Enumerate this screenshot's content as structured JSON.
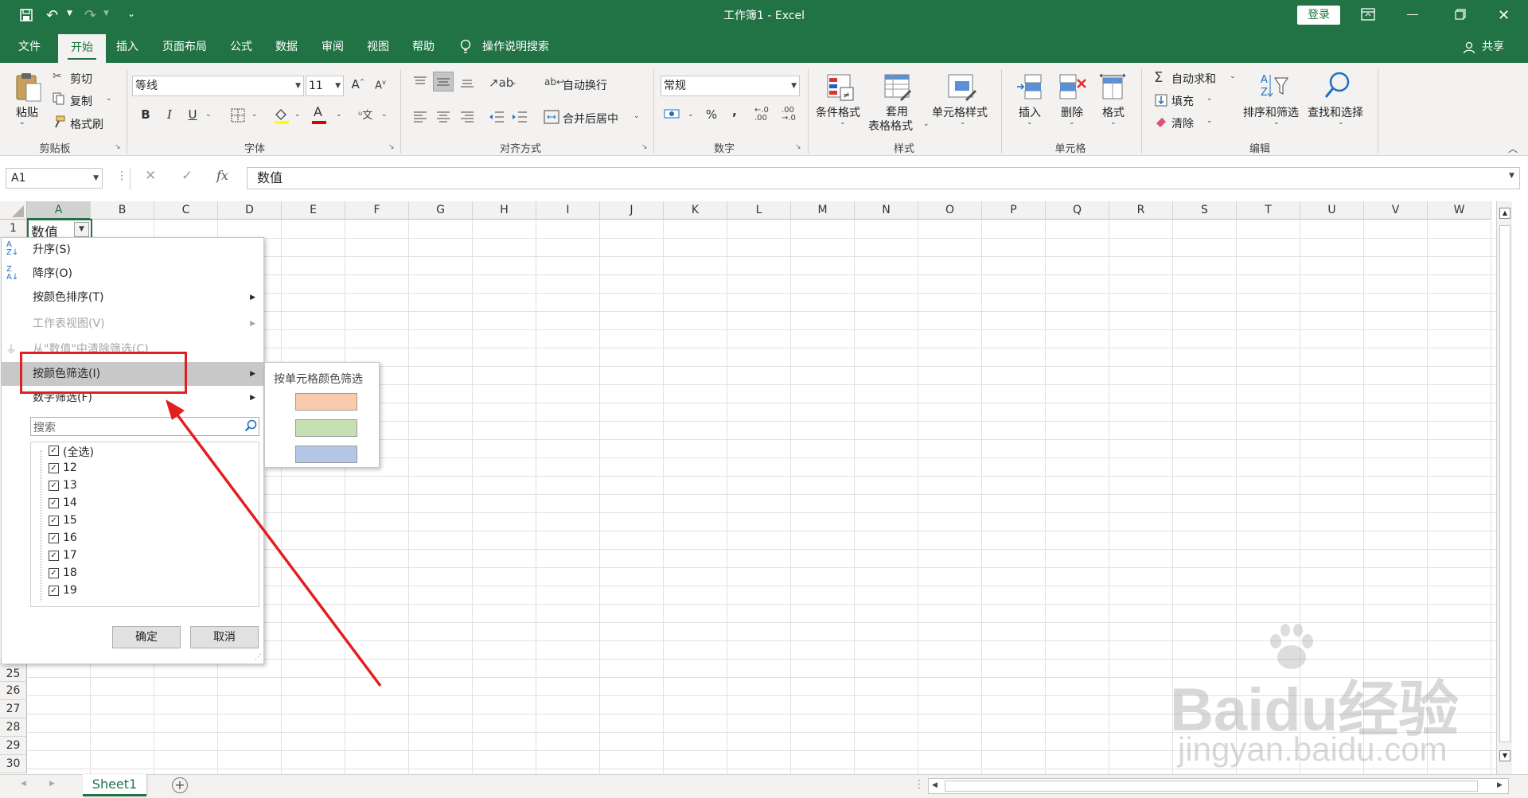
{
  "title_bar": {
    "title": "工作簿1  -  Excel",
    "login_label": "登录"
  },
  "tabs": [
    "文件",
    "开始",
    "插入",
    "页面布局",
    "公式",
    "数据",
    "审阅",
    "视图",
    "帮助"
  ],
  "tell_me": "操作说明搜索",
  "share_label": "共享",
  "ribbon": {
    "clipboard": {
      "paste": "粘贴",
      "cut": "剪切",
      "copy": "复制",
      "format_painter": "格式刷",
      "group": "剪贴板"
    },
    "font": {
      "font_name": "等线",
      "font_size": "11",
      "group": "字体",
      "bold": "B",
      "italic": "I",
      "underline": "U"
    },
    "alignment": {
      "wrap_text": "自动换行",
      "merge_center": "合并后居中",
      "group": "对齐方式"
    },
    "number": {
      "format": "常规",
      "group": "数字"
    },
    "styles": {
      "conditional": "条件格式",
      "table_line1": "套用",
      "table_line2": "表格格式",
      "cell_styles": "单元格样式",
      "group": "样式"
    },
    "cells": {
      "insert": "插入",
      "delete": "删除",
      "format": "格式",
      "group": "单元格"
    },
    "editing": {
      "autosum": "自动求和",
      "fill": "填充",
      "clear": "清除",
      "sort_filter": "排序和筛选",
      "find_select": "查找和选择",
      "group": "编辑"
    }
  },
  "formula_bar": {
    "name_box": "A1",
    "fx": "fx",
    "content": "数值"
  },
  "columns": [
    "A",
    "B",
    "C",
    "D",
    "E",
    "F",
    "G",
    "H",
    "I",
    "J",
    "K",
    "L",
    "M",
    "N",
    "O",
    "P",
    "Q",
    "R",
    "S",
    "T",
    "U",
    "V",
    "W"
  ],
  "rows_visible": [
    "1",
    "25",
    "26",
    "27",
    "28",
    "29",
    "30"
  ],
  "cell_a1": "数值",
  "filter_menu": {
    "items": [
      {
        "label": "升序(S)",
        "disabled": false,
        "submenu": false
      },
      {
        "label": "降序(O)",
        "disabled": false,
        "submenu": false
      },
      {
        "label": "按颜色排序(T)",
        "disabled": false,
        "submenu": true
      },
      {
        "label": "工作表视图(V)",
        "disabled": true,
        "submenu": true
      },
      {
        "label": "从\"数值\"中清除筛选(C)",
        "disabled": true,
        "submenu": false
      },
      {
        "label": "按颜色筛选(I)",
        "disabled": false,
        "submenu": true
      },
      {
        "label": "数字筛选(F)",
        "disabled": false,
        "submenu": true
      }
    ],
    "search_placeholder": "搜索",
    "checklist": [
      "(全选)",
      "12",
      "13",
      "14",
      "15",
      "16",
      "17",
      "18",
      "19"
    ],
    "ok": "确定",
    "cancel": "取消"
  },
  "color_submenu": {
    "title": "按单元格颜色筛选",
    "colors": [
      "#F8CBAD",
      "#C6E0B4",
      "#B4C6E7"
    ]
  },
  "sheet_tab": "Sheet1",
  "watermark": {
    "brand": "Baidu经验",
    "url": "jingyan.baidu.com"
  },
  "accent_color": "#217346",
  "annotation_color": "#E02020"
}
